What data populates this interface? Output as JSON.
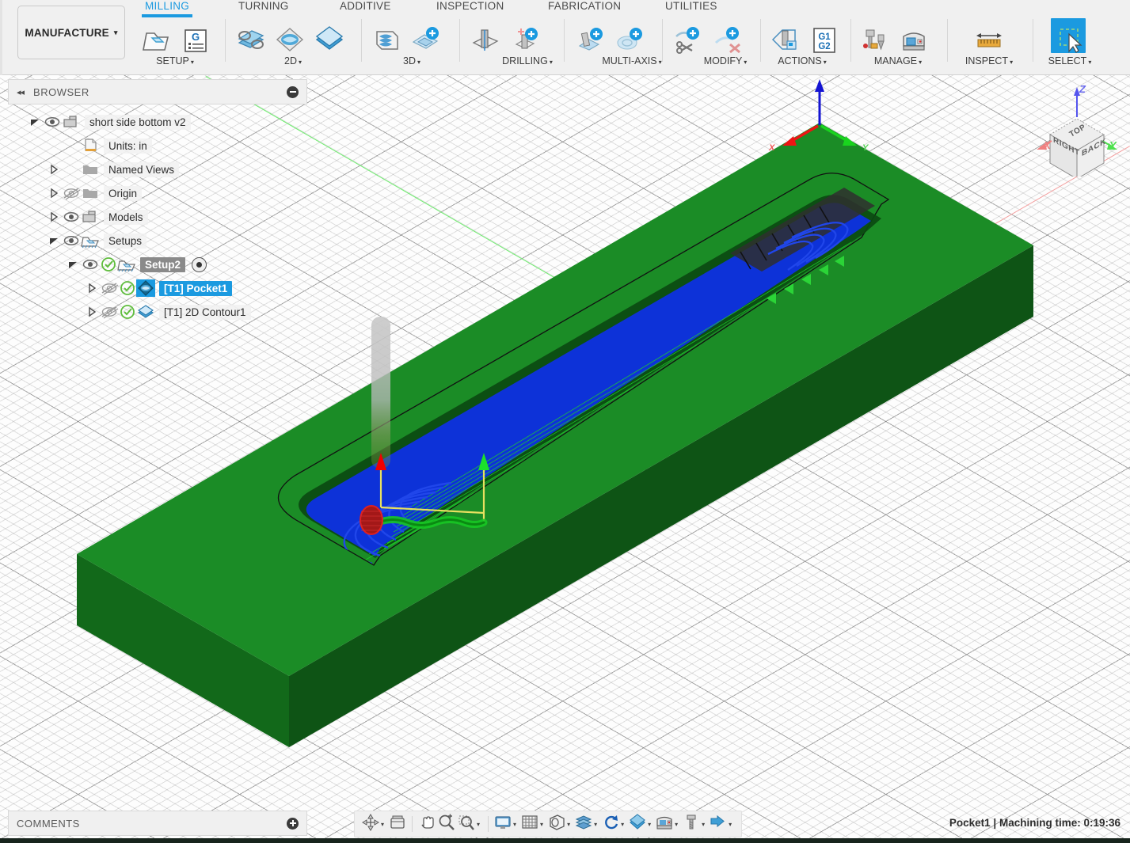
{
  "app": {
    "workspace_label": "MANUFACTURE",
    "caret": "▾"
  },
  "ribbon": {
    "tabs": [
      {
        "label": "MILLING",
        "active": true
      },
      {
        "label": "TURNING",
        "active": false
      },
      {
        "label": "ADDITIVE",
        "active": false
      },
      {
        "label": "INSPECTION",
        "active": false
      },
      {
        "label": "FABRICATION",
        "active": false
      },
      {
        "label": "UTILITIES",
        "active": false
      }
    ],
    "panels": [
      {
        "label": "SETUP",
        "caret": "▾"
      },
      {
        "label": "2D",
        "caret": "▾"
      },
      {
        "label": "3D",
        "caret": "▾"
      },
      {
        "label": "DRILLING",
        "caret": "▾"
      },
      {
        "label": "MULTI-AXIS",
        "caret": "▾"
      },
      {
        "label": "MODIFY",
        "caret": "▾"
      },
      {
        "label": "ACTIONS",
        "caret": "▾"
      },
      {
        "label": "MANAGE",
        "caret": "▾"
      },
      {
        "label": "INSPECT",
        "caret": "▾"
      },
      {
        "label": "SELECT",
        "caret": "▾"
      }
    ],
    "gcode_icon_text_1": "G1",
    "gcode_icon_text_2": "G2"
  },
  "browser": {
    "title": "BROWSER",
    "collapse_glyph": "◂◂",
    "items": [
      {
        "label": "short side bottom v2",
        "icon": "component-icon",
        "indent": 0,
        "twisty": "down",
        "eye": "visible",
        "check": "none",
        "state": "normal"
      },
      {
        "label": "Units: in",
        "icon": "document-icon",
        "indent": 1,
        "twisty": "none",
        "eye": "none",
        "check": "none",
        "state": "normal"
      },
      {
        "label": "Named Views",
        "icon": "folder-icon",
        "indent": 1,
        "twisty": "right",
        "eye": "none",
        "check": "none",
        "state": "normal"
      },
      {
        "label": "Origin",
        "icon": "folder-icon",
        "indent": 1,
        "twisty": "right",
        "eye": "hidden",
        "check": "none",
        "state": "normal"
      },
      {
        "label": "Models",
        "icon": "component-icon",
        "indent": 1,
        "twisty": "right",
        "eye": "visible",
        "check": "none",
        "state": "normal"
      },
      {
        "label": "Setups",
        "icon": "setupfolder-icon",
        "indent": 1,
        "twisty": "down",
        "eye": "visible",
        "check": "none",
        "state": "normal"
      },
      {
        "label": "Setup2",
        "icon": "setupfolder-icon",
        "indent": 2,
        "twisty": "down",
        "eye": "visible",
        "check": "green",
        "state": "sel-grey",
        "radio": true
      },
      {
        "label": "[T1] Pocket1",
        "icon": "pocket-icon",
        "indent": 3,
        "twisty": "right",
        "eye": "hidden",
        "check": "green",
        "state": "sel-blue"
      },
      {
        "label": "[T1] 2D Contour1",
        "icon": "contour-icon",
        "indent": 3,
        "twisty": "right",
        "eye": "hidden",
        "check": "green",
        "state": "normal"
      }
    ]
  },
  "comments": {
    "title": "COMMENTS"
  },
  "navbar": {
    "items": [
      {
        "name": "orbit-icon",
        "caret": "▾"
      },
      {
        "name": "look-at-icon",
        "caret": ""
      },
      {
        "name": "pan-icon",
        "caret": ""
      },
      {
        "name": "zoom-icon",
        "caret": ""
      },
      {
        "name": "zoom-window-icon",
        "caret": "▾"
      },
      {
        "name": "display-settings-icon",
        "caret": "▾"
      },
      {
        "name": "grid-snaps-icon",
        "caret": "▾"
      },
      {
        "name": "viewports-icon",
        "caret": "▾"
      },
      {
        "name": "stock-visibility-icon",
        "caret": "▾"
      },
      {
        "name": "simulate-icon",
        "caret": "▾"
      },
      {
        "name": "toolpath-icon",
        "caret": "▾"
      },
      {
        "name": "machine-icon",
        "caret": "▾"
      },
      {
        "name": "tool-library-icon",
        "caret": "▾"
      },
      {
        "name": "post-process-icon",
        "caret": "▾"
      }
    ]
  },
  "status": {
    "text": "Pocket1 | Machining time: 0:19:36"
  },
  "viewcube": {
    "face_top": "TOP",
    "face_left": "RIGHT",
    "face_right": "BACK",
    "axis_x": "X",
    "axis_y": "Y",
    "axis_z": "Z"
  },
  "colors": {
    "accent": "#1b9ae0",
    "stock_top": "#1b8c26",
    "stock_front": "#14711d",
    "stock_right": "#0f5a17",
    "pocket_floor": "#1040e8",
    "toolpath_blue": "#0d32d8",
    "toolpath_green": "#14c41f",
    "rapid_yellow": "#e8e060",
    "leadin_red": "#f00000",
    "leadout_green": "#19e029",
    "axis_x_red": "#f2a0a0",
    "axis_y_green": "#6ff06f",
    "ribbon_bg": "#f0f0f0",
    "check_green": "#5fbd3d"
  }
}
